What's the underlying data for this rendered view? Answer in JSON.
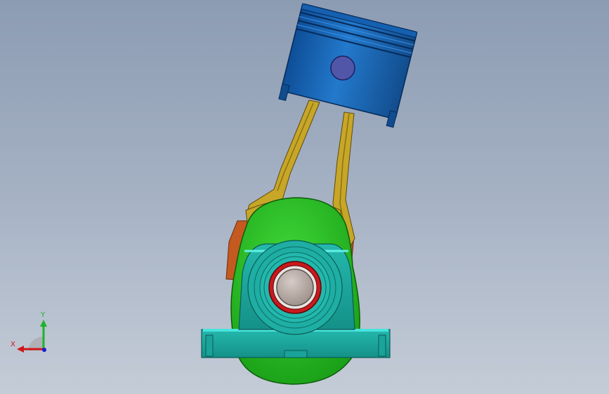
{
  "viewport": {
    "background_top": "#8c9cb3",
    "background_bottom": "#c4ccd7"
  },
  "model": {
    "parts": [
      "piston",
      "piston-pin",
      "connecting-rod",
      "crank-counterweight",
      "crank-web",
      "bearing-housing",
      "pillow-block-base",
      "shaft",
      "bearing-ring"
    ],
    "colors": {
      "piston": "#1f6fc0",
      "piston_pin": "#5357a8",
      "connecting_rod": "#c9a625",
      "counterweight": "#24c21e",
      "crank_web": "#c85a1e",
      "bearing_housing": "#1aa69b",
      "bearing_ring": "#c81a1e",
      "shaft": "#b7a9a4"
    }
  },
  "triad": {
    "x_label": "X",
    "y_label": "Y",
    "x_color": "#d01818",
    "y_color": "#1db32a",
    "z_color": "#1a1ad0"
  }
}
